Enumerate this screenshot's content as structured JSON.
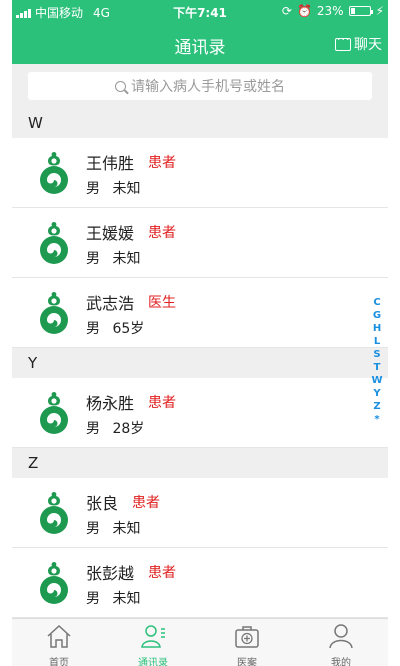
{
  "status_bar": {
    "carrier": "中国移动",
    "network": "4G",
    "time": "下午7:41",
    "battery_percent": "23%",
    "battery_level": 0.23
  },
  "nav": {
    "title": "通讯录",
    "chat_label": "聊天"
  },
  "search": {
    "placeholder": "请输入病人手机号或姓名"
  },
  "sections": [
    {
      "letter": "W",
      "contacts": [
        {
          "name": "王伟胜",
          "role": "患者",
          "gender": "男",
          "age": "未知"
        },
        {
          "name": "王媛媛",
          "role": "患者",
          "gender": "男",
          "age": "未知"
        },
        {
          "name": "武志浩",
          "role": "医生",
          "gender": "男",
          "age": "65岁"
        }
      ]
    },
    {
      "letter": "Y",
      "contacts": [
        {
          "name": "杨永胜",
          "role": "患者",
          "gender": "男",
          "age": "28岁"
        }
      ]
    },
    {
      "letter": "Z",
      "contacts": [
        {
          "name": "张良",
          "role": "患者",
          "gender": "男",
          "age": "未知"
        },
        {
          "name": "张彭越",
          "role": "患者",
          "gender": "男",
          "age": "未知"
        }
      ]
    }
  ],
  "index_letters": [
    "C",
    "G",
    "H",
    "L",
    "S",
    "T",
    "W",
    "Y",
    "Z",
    "*"
  ],
  "tabs": [
    {
      "label": "首页",
      "icon": "home-icon",
      "active": false
    },
    {
      "label": "通讯录",
      "icon": "contacts-icon",
      "active": true
    },
    {
      "label": "医案",
      "icon": "medical-case-icon",
      "active": false
    },
    {
      "label": "我的",
      "icon": "profile-icon",
      "active": false
    }
  ],
  "colors": {
    "brand_green": "#2cc17b",
    "role_red": "#e02020",
    "index_blue": "#1a8fe0"
  }
}
